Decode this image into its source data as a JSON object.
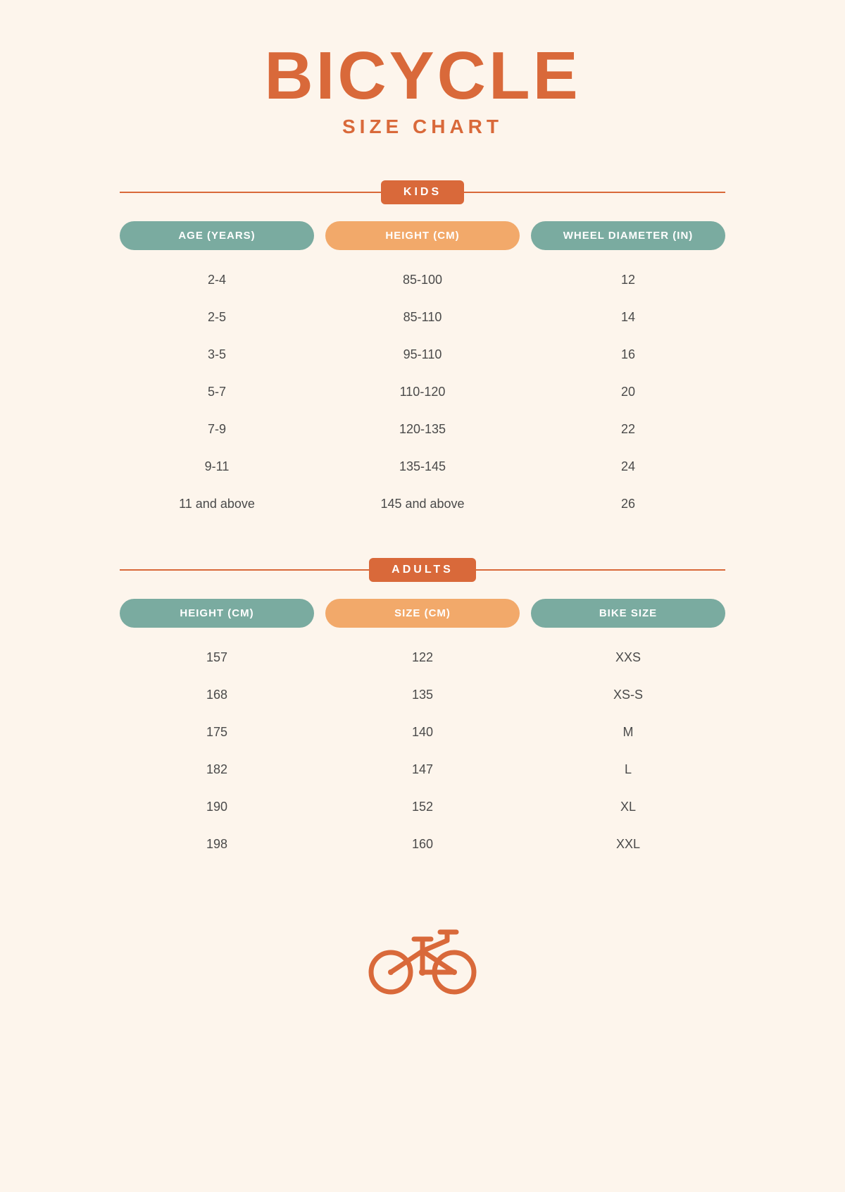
{
  "title": {
    "main": "BICYCLE",
    "sub": "SIZE CHART"
  },
  "kids": {
    "badge": "KIDS",
    "headers": [
      "AGE (years)",
      "HEIGHT (cm)",
      "WHEEL DIAMETER (in)"
    ],
    "header_styles": [
      "teal",
      "orange",
      "teal"
    ],
    "rows": [
      [
        "2-4",
        "85-100",
        "12"
      ],
      [
        "2-5",
        "85-110",
        "14"
      ],
      [
        "3-5",
        "95-110",
        "16"
      ],
      [
        "5-7",
        "110-120",
        "20"
      ],
      [
        "7-9",
        "120-135",
        "22"
      ],
      [
        "9-11",
        "135-145",
        "24"
      ],
      [
        "11 and above",
        "145 and above",
        "26"
      ]
    ]
  },
  "adults": {
    "badge": "ADULTS",
    "headers": [
      "HEIGHT (cm)",
      "SIZE (cm)",
      "BIKE SIZE"
    ],
    "header_styles": [
      "teal",
      "orange",
      "teal"
    ],
    "rows": [
      [
        "157",
        "122",
        "XXS"
      ],
      [
        "168",
        "135",
        "XS-S"
      ],
      [
        "175",
        "140",
        "M"
      ],
      [
        "182",
        "147",
        "L"
      ],
      [
        "190",
        "152",
        "XL"
      ],
      [
        "198",
        "160",
        "XXL"
      ]
    ]
  }
}
